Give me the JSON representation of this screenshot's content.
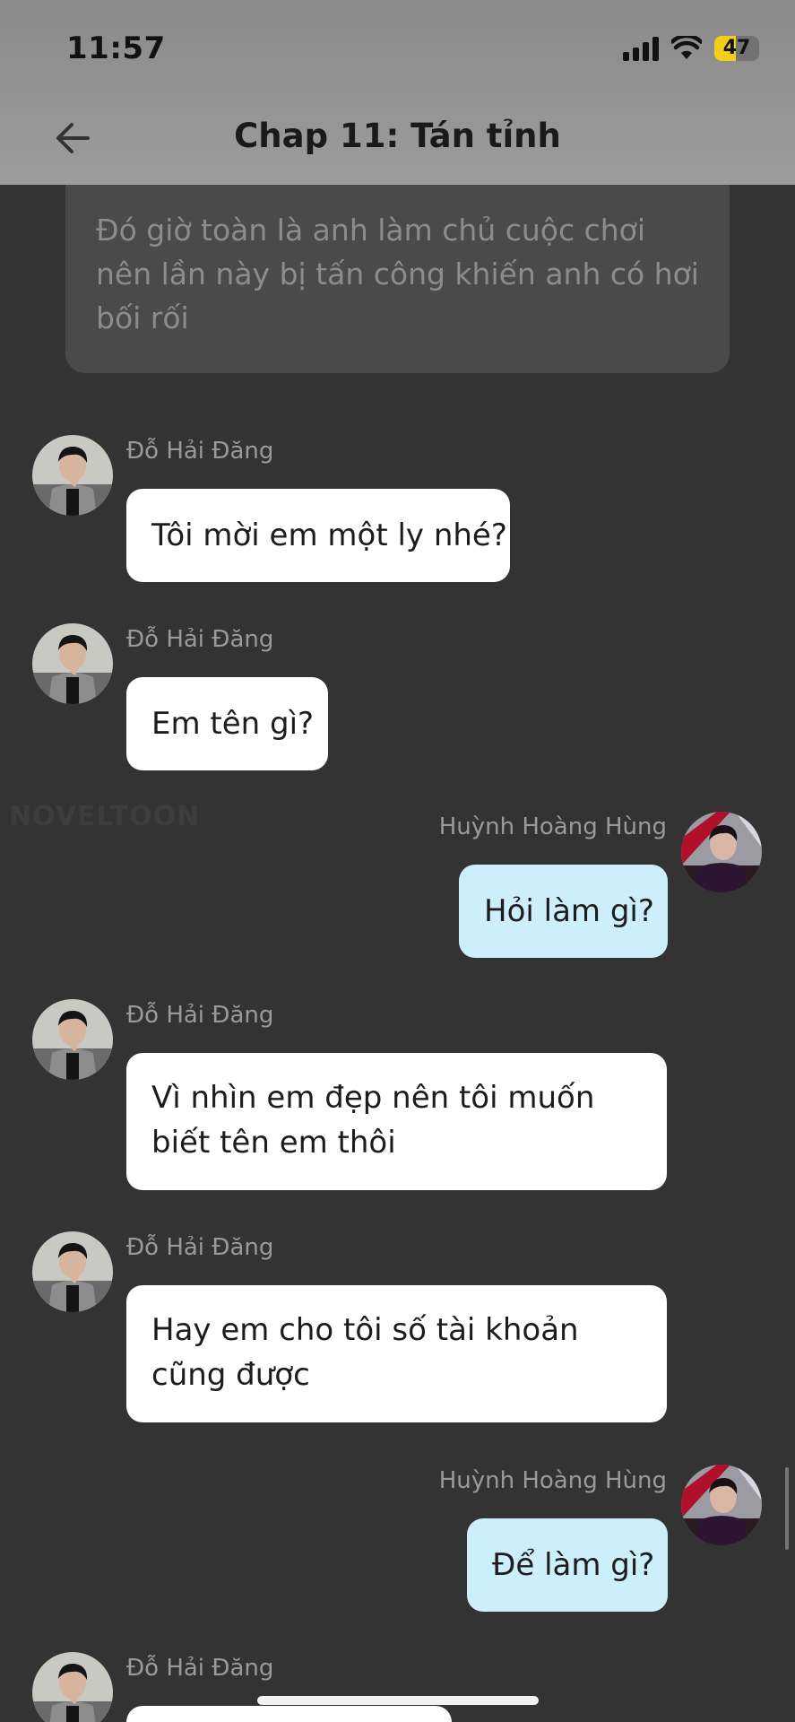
{
  "status_bar": {
    "time": "11:57",
    "battery_level": "47",
    "battery_fraction": 0.47,
    "battery_color": "#f2cd1c",
    "icons": [
      "signal-icon",
      "wifi-icon",
      "battery-icon"
    ]
  },
  "nav": {
    "back_icon": "arrow-left-icon",
    "title": "Chap 11: Tán tỉnh"
  },
  "narration": {
    "text": "Đó giờ toàn là anh làm chủ cuộc chơi nên lần này bị tấn công khiến anh có hơi bối rối"
  },
  "watermark": "NOVELTOON",
  "messages": [
    {
      "side": "left",
      "sender": "Đỗ Hải Đăng",
      "text": "Tôi mời em một ly nhé?"
    },
    {
      "side": "left",
      "sender": "Đỗ Hải Đăng",
      "text": "Em tên gì?"
    },
    {
      "side": "right",
      "sender": "Huỳnh Hoàng Hùng",
      "text": "Hỏi làm gì?"
    },
    {
      "side": "left",
      "sender": "Đỗ Hải Đăng",
      "text": "Vì nhìn em đẹp nên tôi muốn biết tên em thôi"
    },
    {
      "side": "left",
      "sender": "Đỗ Hải Đăng",
      "text": "Hay em cho tôi số tài khoản cũng được"
    },
    {
      "side": "right",
      "sender": "Huỳnh Hoàng Hùng",
      "text": "Để làm gì?"
    },
    {
      "side": "left",
      "sender": "Đỗ Hải Đăng",
      "text": ""
    }
  ],
  "colors": {
    "background": "#333333",
    "header": "#8a8a8a",
    "left_bubble": "#ffffff",
    "right_bubble": "#cdeefb"
  }
}
